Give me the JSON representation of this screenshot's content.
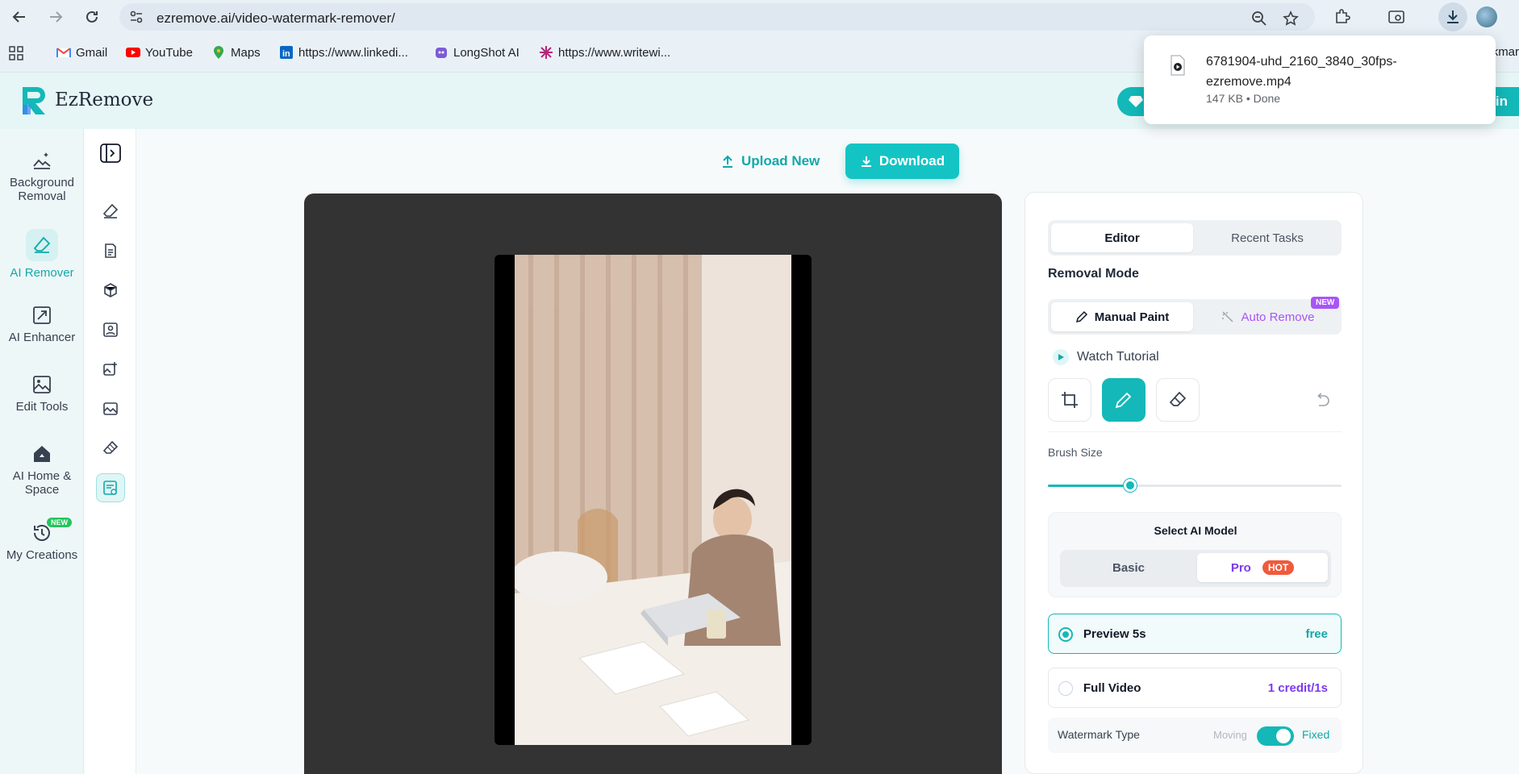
{
  "browser": {
    "url": "ezremove.ai/video-watermark-remover/",
    "bookmarks": [
      {
        "label": "Gmail",
        "icon": "gmail-icon"
      },
      {
        "label": "YouTube",
        "icon": "youtube-icon"
      },
      {
        "label": "Maps",
        "icon": "maps-icon"
      },
      {
        "label": "https://www.linkedi...",
        "icon": "linkedin-icon"
      },
      {
        "label": "LongShot AI",
        "icon": "longshot-icon"
      },
      {
        "label": "https://www.writewi...",
        "icon": "writewise-icon"
      }
    ],
    "bookmarks_overflow": "Bookmar"
  },
  "download_popup": {
    "filename": "6781904-uhd_2160_3840_30fps-ezremove.mp4",
    "status": "147 KB • Done"
  },
  "app": {
    "brand": "EzRemove",
    "login_label": "Log in",
    "brand_color": "#13b8b8"
  },
  "left_nav": [
    {
      "label": "Background Removal",
      "icon": "background-removal-icon",
      "active": false
    },
    {
      "label": "AI Remover",
      "icon": "eraser-icon",
      "active": true
    },
    {
      "label": "AI Enhancer",
      "icon": "enhancer-icon",
      "active": false
    },
    {
      "label": "Edit Tools",
      "icon": "image-icon",
      "active": false
    },
    {
      "label": "AI Home & Space",
      "icon": "home-icon",
      "active": false
    },
    {
      "label": "My Creations",
      "icon": "history-icon",
      "active": false,
      "badge": "NEW"
    }
  ],
  "toolbar": {
    "upload_label": "Upload New",
    "download_label": "Download"
  },
  "panel": {
    "tabs": [
      "Editor",
      "Recent Tasks"
    ],
    "removal_mode_title": "Removal Mode",
    "modes": [
      "Manual Paint",
      "Auto Remove"
    ],
    "auto_remove_badge": "NEW",
    "watch_tutorial": "Watch Tutorial",
    "brush_size_label": "Brush Size",
    "brush_size_fraction": 0.28,
    "model_title": "Select AI Model",
    "models": [
      "Basic",
      "Pro"
    ],
    "pro_badge": "HOT",
    "preview_label": "Preview 5s",
    "preview_price": "free",
    "full_label": "Full Video",
    "full_price": "1 credit/1s",
    "watermark_type_label": "Watermark Type",
    "wm_option_off": "Moving",
    "wm_option_on": "Fixed"
  }
}
